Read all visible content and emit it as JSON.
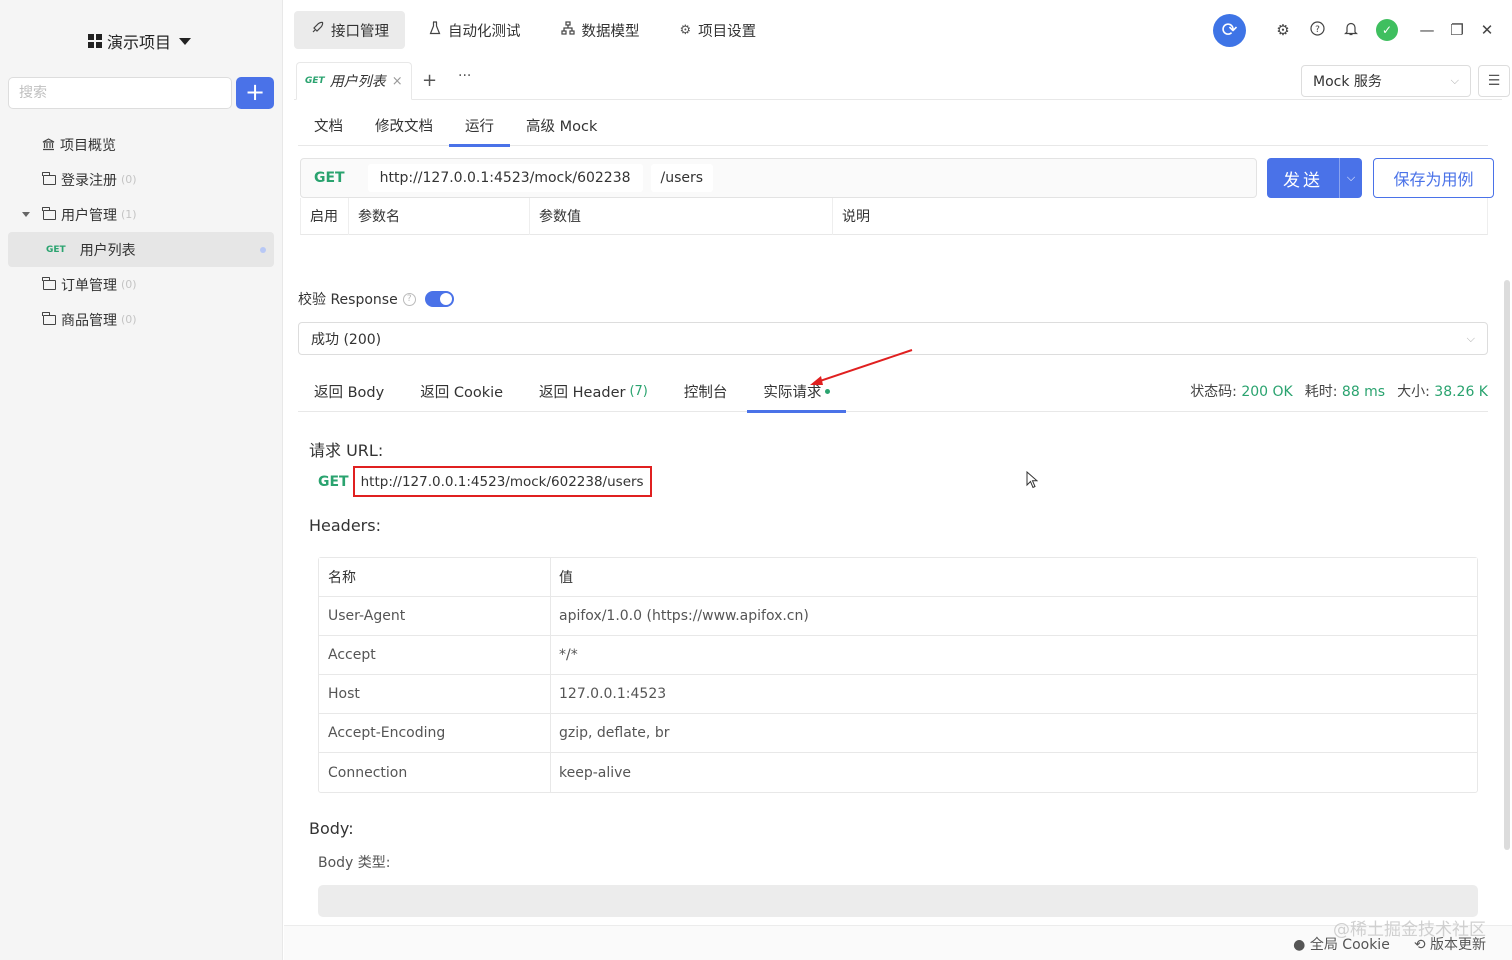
{
  "sidebar": {
    "project_name": "演示项目",
    "search_placeholder": "搜索",
    "add_label": "+",
    "tree": [
      {
        "label": "项目概览",
        "count": ""
      },
      {
        "label": "登录注册",
        "count": "(0)"
      },
      {
        "label": "用户管理",
        "count": "(1)"
      },
      {
        "label": "用户列表",
        "method": "GET"
      },
      {
        "label": "订单管理",
        "count": "(0)"
      },
      {
        "label": "商品管理",
        "count": "(0)"
      }
    ]
  },
  "topnav": {
    "items": [
      {
        "label": "接口管理",
        "icon": "rocket-icon"
      },
      {
        "label": "自动化测试",
        "icon": "flask-icon"
      },
      {
        "label": "数据模型",
        "icon": "sitemap-icon"
      },
      {
        "label": "项目设置",
        "icon": "gear-icon"
      }
    ]
  },
  "tabs": {
    "open_tab": {
      "method": "GET",
      "label": "用户列表",
      "close": "×"
    },
    "add": "+",
    "more": "···",
    "mock_service": "Mock 服务"
  },
  "subtabs": [
    "文档",
    "修改文档",
    "运行",
    "高级 Mock"
  ],
  "request": {
    "method": "GET",
    "base_url": "http://127.0.0.1:4523/mock/602238",
    "path": "/users",
    "send_label": "发送",
    "save_label": "保存为用例"
  },
  "params_table": {
    "headers": [
      "启用",
      "参数名",
      "参数值",
      "说明"
    ]
  },
  "validate": {
    "label": "校验 Response",
    "enabled": true
  },
  "response_select": "成功 (200)",
  "response_tabs": [
    {
      "label": "返回 Body"
    },
    {
      "label": "返回 Cookie"
    },
    {
      "label": "返回 Header",
      "count": "(7)"
    },
    {
      "label": "控制台"
    },
    {
      "label": "实际请求"
    }
  ],
  "stats": {
    "status_label": "状态码:",
    "status_value": "200 OK",
    "time_label": "耗时:",
    "time_value": "88 ms",
    "size_label": "大小:",
    "size_value": "38.26 K"
  },
  "actual": {
    "url_title": "请求 URL:",
    "method": "GET",
    "url": "http://127.0.0.1:4523/mock/602238/users",
    "headers_title": "Headers:",
    "table_headers": [
      "名称",
      "值"
    ],
    "rows": [
      [
        "User-Agent",
        "apifox/1.0.0 (https://www.apifox.cn)"
      ],
      [
        "Accept",
        "*/*"
      ],
      [
        "Host",
        "127.0.0.1:4523"
      ],
      [
        "Accept-Encoding",
        "gzip, deflate, br"
      ],
      [
        "Connection",
        "keep-alive"
      ]
    ],
    "body_title": "Body:",
    "body_type_label": "Body 类型:"
  },
  "footer": {
    "watermark": "@稀土掘金技术社区",
    "cookie_label": "全局 Cookie",
    "update_label": "版本更新"
  },
  "colors": {
    "accent": "#4a72e8",
    "get_method": "#2aa36f",
    "highlight": "#e02020"
  }
}
